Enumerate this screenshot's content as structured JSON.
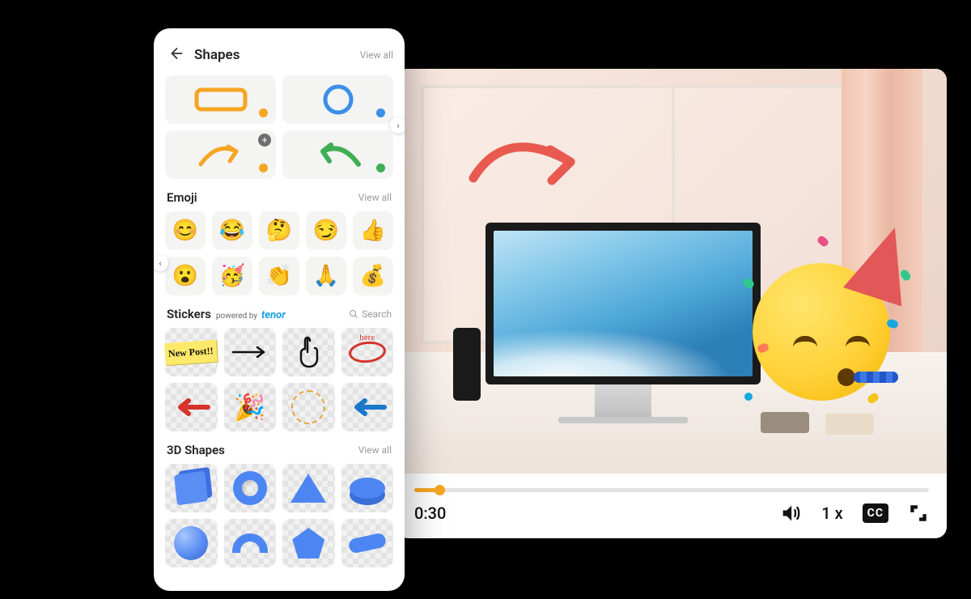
{
  "panel": {
    "title": "Shapes",
    "view_all": "View all",
    "sections": {
      "emoji": {
        "title": "Emoji",
        "view_all": "View all"
      },
      "stickers": {
        "title": "Stickers",
        "powered_prefix": "powered by",
        "powered_brand": "tenor",
        "search": "Search"
      },
      "shapes3d": {
        "title": "3D Shapes",
        "view_all": "View all"
      }
    },
    "shapes": [
      {
        "name": "rectangle",
        "color": "#f5a623"
      },
      {
        "name": "circle",
        "color": "#3a8fe6"
      },
      {
        "name": "arrow-right-curved",
        "color": "#f5a623",
        "badge": "+"
      },
      {
        "name": "arrow-left-curved",
        "color": "#3fae55"
      }
    ],
    "emoji": [
      "😊",
      "😂",
      "🤔",
      "😏",
      "👍",
      "😮",
      "🥳",
      "👏",
      "🙏",
      "💰"
    ],
    "stickers": [
      {
        "name": "new-post",
        "label": "New Post!!"
      },
      {
        "name": "arrow-right-thin"
      },
      {
        "name": "pointing-hand"
      },
      {
        "name": "circled-here",
        "label": "here"
      },
      {
        "name": "arrow-left-red"
      },
      {
        "name": "party-popper",
        "glyph": "🎉"
      },
      {
        "name": "dashed-circle"
      },
      {
        "name": "arrow-left-blue"
      }
    ],
    "shapes3d": [
      "cube",
      "torus",
      "cone",
      "cylinder",
      "sphere",
      "arc",
      "pentagon",
      "curve"
    ]
  },
  "video": {
    "timestamp": "0:30",
    "speed": "1 x",
    "cc": "CC",
    "overlays": {
      "arrow_color": "#e85a4f",
      "emoji": "party-face"
    }
  },
  "colors": {
    "accent": "#f5a623",
    "blue": "#3a8fe6",
    "green": "#3fae55",
    "red": "#e85a4f"
  }
}
